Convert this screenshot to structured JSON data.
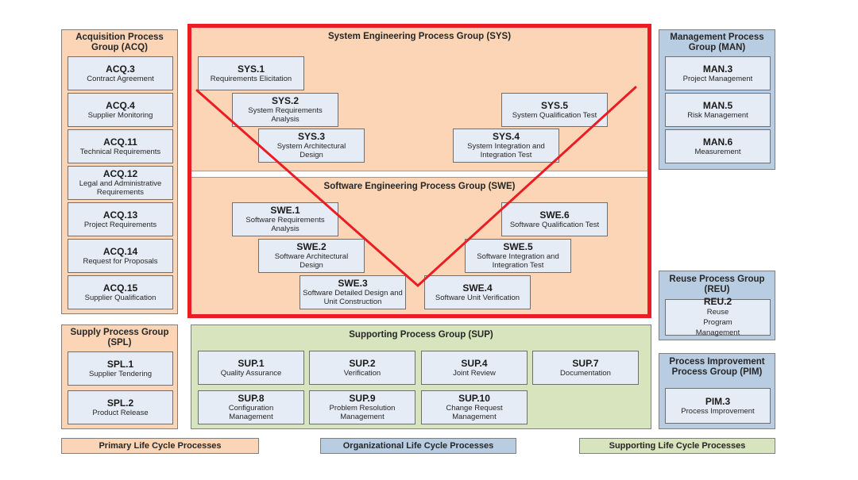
{
  "acq": {
    "title": "Acquisition Process Group (ACQ)",
    "items": [
      {
        "id": "ACQ.3",
        "name": "Contract Agreement"
      },
      {
        "id": "ACQ.4",
        "name": "Supplier Monitoring"
      },
      {
        "id": "ACQ.11",
        "name": "Technical Requirements"
      },
      {
        "id": "ACQ.12",
        "name": "Legal and Administrative Requirements"
      },
      {
        "id": "ACQ.13",
        "name": "Project Requirements"
      },
      {
        "id": "ACQ.14",
        "name": "Request for Proposals"
      },
      {
        "id": "ACQ.15",
        "name": "Supplier Qualification"
      }
    ]
  },
  "spl": {
    "title": "Supply Process Group (SPL)",
    "items": [
      {
        "id": "SPL.1",
        "name": "Supplier Tendering"
      },
      {
        "id": "SPL.2",
        "name": "Product Release"
      }
    ]
  },
  "sys": {
    "title": "System Engineering Process Group (SYS)",
    "items": [
      {
        "id": "SYS.1",
        "name": "Requirements Elicitation"
      },
      {
        "id": "SYS.2",
        "name": "System Requirements Analysis"
      },
      {
        "id": "SYS.3",
        "name": "System Architectural Design"
      },
      {
        "id": "SYS.4",
        "name": "System Integration and Integration Test"
      },
      {
        "id": "SYS.5",
        "name": "System Qualification Test"
      }
    ]
  },
  "swe": {
    "title": "Software Engineering Process Group (SWE)",
    "items": [
      {
        "id": "SWE.1",
        "name": "Software Requirements Analysis"
      },
      {
        "id": "SWE.2",
        "name": "Software Architectural Design"
      },
      {
        "id": "SWE.3",
        "name": "Software Detailed Design and Unit Construction"
      },
      {
        "id": "SWE.4",
        "name": "Software Unit Verification"
      },
      {
        "id": "SWE.5",
        "name": "Software Integration and Integration Test"
      },
      {
        "id": "SWE.6",
        "name": "Software Qualification Test"
      }
    ]
  },
  "sup": {
    "title": "Supporting Process Group (SUP)",
    "items": [
      {
        "id": "SUP.1",
        "name": "Quality Assurance"
      },
      {
        "id": "SUP.2",
        "name": "Verification"
      },
      {
        "id": "SUP.4",
        "name": "Joint Review"
      },
      {
        "id": "SUP.7",
        "name": "Documentation"
      },
      {
        "id": "SUP.8",
        "name": "Configuration Management"
      },
      {
        "id": "SUP.9",
        "name": "Problem Resolution Management"
      },
      {
        "id": "SUP.10",
        "name": "Change Request Management"
      }
    ]
  },
  "man": {
    "title": "Management Process Group (MAN)",
    "items": [
      {
        "id": "MAN.3",
        "name": "Project Management"
      },
      {
        "id": "MAN.5",
        "name": "Risk Management"
      },
      {
        "id": "MAN.6",
        "name": "Measurement"
      }
    ]
  },
  "reu": {
    "title": "Reuse Process Group (REU)",
    "items": [
      {
        "id": "REU.2",
        "name": "Reuse Program Management"
      }
    ]
  },
  "pim": {
    "title": "Process Improvement Process Group (PIM)",
    "items": [
      {
        "id": "PIM.3",
        "name": "Process Improvement"
      }
    ]
  },
  "legend": {
    "primary": "Primary Life Cycle Processes",
    "organizational": "Organizational Life Cycle Processes",
    "supporting": "Supporting Life Cycle Processes"
  },
  "colors": {
    "primary": "#fbd5b5",
    "organizational": "#b9cde2",
    "supporting": "#d7e4bd",
    "process_box": "#e6ecf5",
    "highlight": "#ec1c24"
  }
}
